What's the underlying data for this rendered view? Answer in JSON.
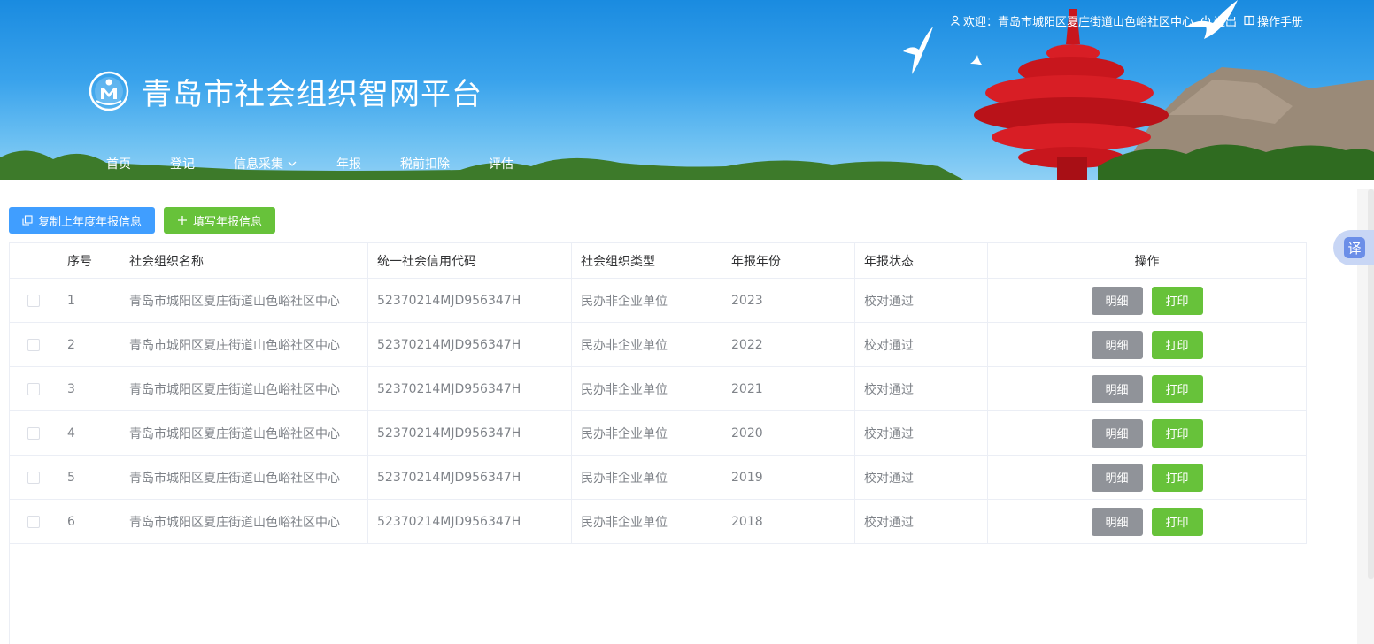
{
  "header": {
    "welcome_text": "欢迎：青岛市城阳区夏庄街道山色峪社区中心",
    "logout_label": "退出",
    "manual_label": "操作手册",
    "app_title": "青岛市社会组织智网平台"
  },
  "nav": {
    "items": [
      {
        "label": "首页"
      },
      {
        "label": "登记"
      },
      {
        "label": "信息采集"
      },
      {
        "label": "年报"
      },
      {
        "label": "税前扣除"
      },
      {
        "label": "评估"
      }
    ]
  },
  "toolbar": {
    "copy_label": "复制上年度年报信息",
    "fill_label": "填写年报信息"
  },
  "table": {
    "columns": [
      "序号",
      "社会组织名称",
      "统一社会信用代码",
      "社会组织类型",
      "年报年份",
      "年报状态",
      "操作"
    ],
    "rows": [
      {
        "idx": "1",
        "name": "青岛市城阳区夏庄街道山色峪社区中心",
        "code": "52370214MJD956347H",
        "type": "民办非企业单位",
        "year": "2023",
        "status": "校对通过"
      },
      {
        "idx": "2",
        "name": "青岛市城阳区夏庄街道山色峪社区中心",
        "code": "52370214MJD956347H",
        "type": "民办非企业单位",
        "year": "2022",
        "status": "校对通过"
      },
      {
        "idx": "3",
        "name": "青岛市城阳区夏庄街道山色峪社区中心",
        "code": "52370214MJD956347H",
        "type": "民办非企业单位",
        "year": "2021",
        "status": "校对通过"
      },
      {
        "idx": "4",
        "name": "青岛市城阳区夏庄街道山色峪社区中心",
        "code": "52370214MJD956347H",
        "type": "民办非企业单位",
        "year": "2020",
        "status": "校对通过"
      },
      {
        "idx": "5",
        "name": "青岛市城阳区夏庄街道山色峪社区中心",
        "code": "52370214MJD956347H",
        "type": "民办非企业单位",
        "year": "2019",
        "status": "校对通过"
      },
      {
        "idx": "6",
        "name": "青岛市城阳区夏庄街道山色峪社区中心",
        "code": "52370214MJD956347H",
        "type": "民办非企业单位",
        "year": "2018",
        "status": "校对通过"
      }
    ],
    "detail_label": "明细",
    "print_label": "打印"
  },
  "translate": {
    "label": "译"
  },
  "colors": {
    "primary": "#409eff",
    "success": "#67c23a",
    "info": "#909399",
    "header_blue": "#1a8be0"
  }
}
